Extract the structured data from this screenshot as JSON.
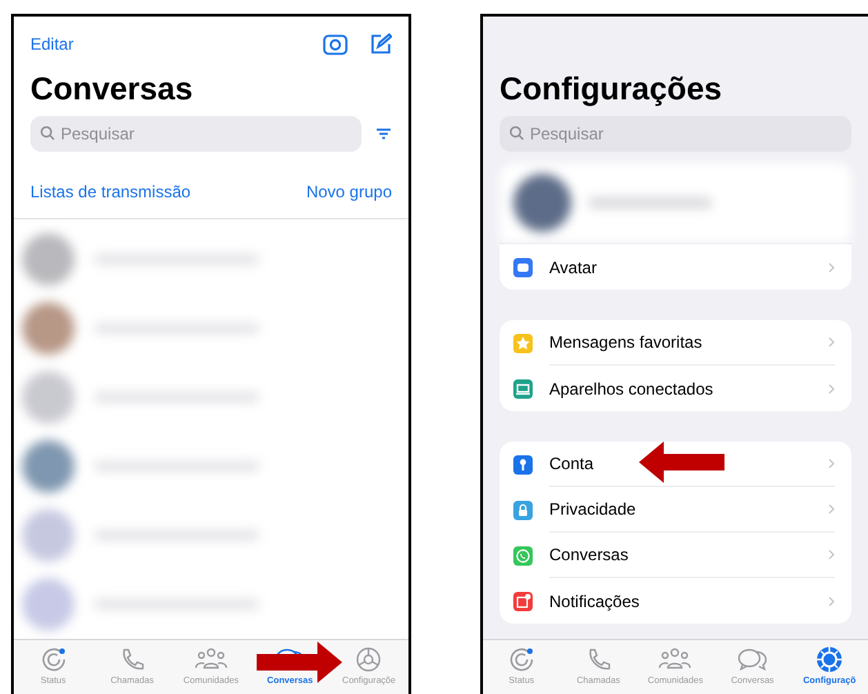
{
  "chats_screen": {
    "edit_link": "Editar",
    "title": "Conversas",
    "search": {
      "placeholder": "Pesquisar"
    },
    "links": [
      "Listas de transmissão",
      "Novo grupo"
    ],
    "tab_bar": [
      {
        "label": "Status",
        "selected": false
      },
      {
        "label": "Chamadas",
        "selected": false
      },
      {
        "label": "Comunidades",
        "selected": false
      },
      {
        "label": "Conversas",
        "selected": true
      },
      {
        "label": "Configuraçõe",
        "selected": false
      }
    ]
  },
  "settings_screen": {
    "title": "Configurações",
    "search": {
      "placeholder": "Pesquisar"
    },
    "groups": [
      [
        {
          "label": "Avatar",
          "color": "#3478f6"
        }
      ],
      [
        {
          "label": "Mensagens favoritas",
          "color": "#f7c21a"
        },
        {
          "label": "Aparelhos conectados",
          "color": "#1fa38a"
        }
      ],
      [
        {
          "label": "Conta",
          "color": "#1a73e8"
        },
        {
          "label": "Privacidade",
          "color": "#38a3e0"
        },
        {
          "label": "Conversas",
          "color": "#34c759"
        },
        {
          "label": "Notificações",
          "color": "#f23b3b"
        }
      ]
    ],
    "tab_bar": [
      {
        "label": "Status",
        "selected": false
      },
      {
        "label": "Chamadas",
        "selected": false
      },
      {
        "label": "Comunidades",
        "selected": false
      },
      {
        "label": "Conversas",
        "selected": false
      },
      {
        "label": "Configuraçõ",
        "selected": true
      }
    ]
  }
}
